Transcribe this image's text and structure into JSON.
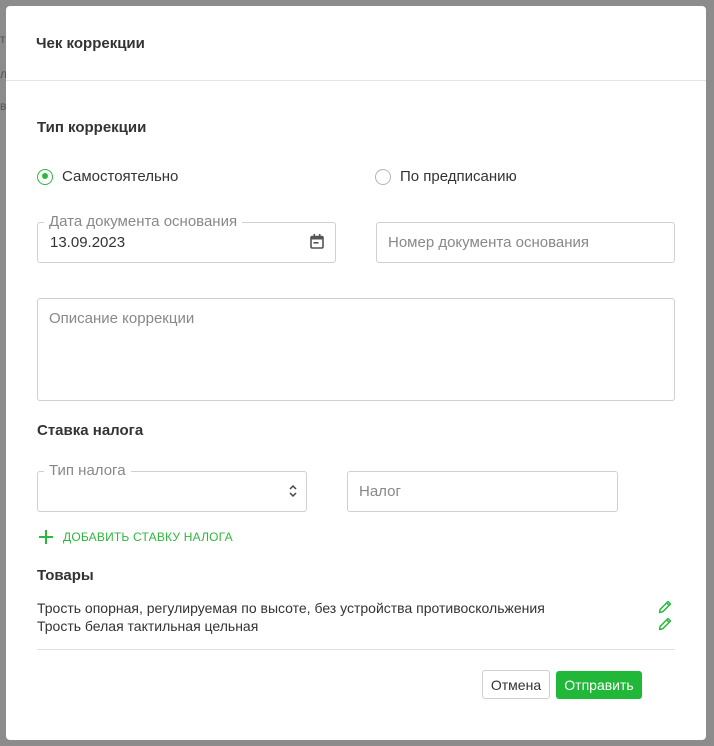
{
  "modal": {
    "title": "Чек коррекции"
  },
  "correction_type": {
    "title": "Тип коррекции",
    "options": [
      {
        "label": "Самостоятельно",
        "checked": true
      },
      {
        "label": "По предписанию",
        "checked": false
      }
    ]
  },
  "doc_date": {
    "label": "Дата документа основания",
    "value": "13.09.2023",
    "icon": "calendar-icon"
  },
  "doc_number": {
    "placeholder": "Номер документа основания"
  },
  "description": {
    "placeholder": "Описание коррекции"
  },
  "tax_rate": {
    "title": "Ставка налога",
    "tax_type_label": "Тип налога",
    "tax_type_value": "",
    "tax_placeholder": "Налог",
    "add_label": "ДОБАВИТЬ СТАВКУ НАЛОГА"
  },
  "goods": {
    "title": "Товары",
    "items": [
      {
        "name": "Трость опорная, регулируемая по высоте, без устройства противоскольжения"
      },
      {
        "name": "Трость белая тактильная цельная"
      }
    ]
  },
  "actions": {
    "cancel_label": "Отмена",
    "submit_label": "Отправить"
  },
  "colors": {
    "accent": "#2db83d",
    "submit_bg": "#21b83a"
  }
}
